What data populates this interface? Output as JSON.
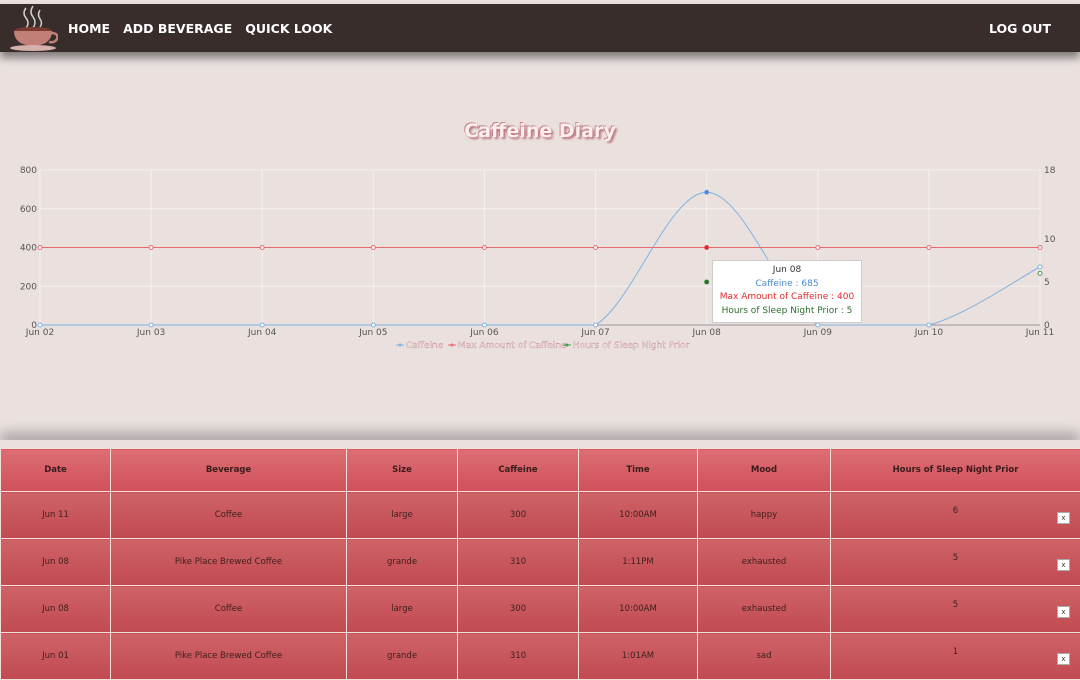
{
  "navbar": {
    "logo_icon": "coffee-cup-icon",
    "links": [
      "HOME",
      "ADD BEVERAGE",
      "QUICK LOOK"
    ],
    "logout": "LOG OUT"
  },
  "page_title": "Caffeine Diary",
  "chart_data": {
    "type": "line",
    "x": [
      "Jun 02",
      "Jun 03",
      "Jun 04",
      "Jun 05",
      "Jun 06",
      "Jun 07",
      "Jun 08",
      "Jun 09",
      "Jun 10",
      "Jun 11"
    ],
    "y_left_ticks": [
      "0",
      "200",
      "400",
      "600",
      "800"
    ],
    "y_right_ticks": [
      "0",
      "5",
      "10",
      "18"
    ],
    "ylim_left": [
      0,
      800
    ],
    "ylim_right": [
      0,
      18
    ],
    "series": [
      {
        "name": "Caffeine",
        "axis": "left",
        "color": "#7fb3e0",
        "smooth": true,
        "values": [
          0,
          0,
          0,
          0,
          0,
          0,
          685,
          0,
          0,
          300
        ]
      },
      {
        "name": "Max Amount of Caffeine",
        "axis": "left",
        "color": "#e8696f",
        "smooth": false,
        "values": [
          400,
          400,
          400,
          400,
          400,
          400,
          400,
          400,
          400,
          400
        ]
      },
      {
        "name": "Hours of Sleep Night Prior",
        "axis": "right",
        "color": "#4c9a4c",
        "smooth": false,
        "values": [
          null,
          null,
          null,
          null,
          null,
          null,
          5,
          null,
          null,
          6
        ]
      }
    ],
    "grid": true,
    "legend": "bottom"
  },
  "tooltip": {
    "date": "Jun 08",
    "caffeine": "Caffeine   :   685",
    "max": "Max Amount of Caffeine   :   400",
    "sleep": "Hours of Sleep Night Prior   :   5"
  },
  "table": {
    "headers": [
      "Date",
      "Beverage",
      "Size",
      "Caffeine",
      "Time",
      "Mood",
      "Hours of Sleep Night Prior"
    ],
    "delete_label": "x",
    "rows": [
      {
        "date": "Jun 11",
        "beverage": "Coffee",
        "size": "large",
        "caffeine": "300",
        "time": "10:00AM",
        "mood": "happy",
        "sleep": "6"
      },
      {
        "date": "Jun 08",
        "beverage": "Pike Place Brewed Coffee",
        "size": "grande",
        "caffeine": "310",
        "time": "1:11PM",
        "mood": "exhausted",
        "sleep": "5"
      },
      {
        "date": "Jun 08",
        "beverage": "Coffee",
        "size": "large",
        "caffeine": "300",
        "time": "10:00AM",
        "mood": "exhausted",
        "sleep": "5"
      },
      {
        "date": "Jun 01",
        "beverage": "Pike Place Brewed Coffee",
        "size": "grande",
        "caffeine": "310",
        "time": "1:01AM",
        "mood": "sad",
        "sleep": "1"
      }
    ]
  }
}
